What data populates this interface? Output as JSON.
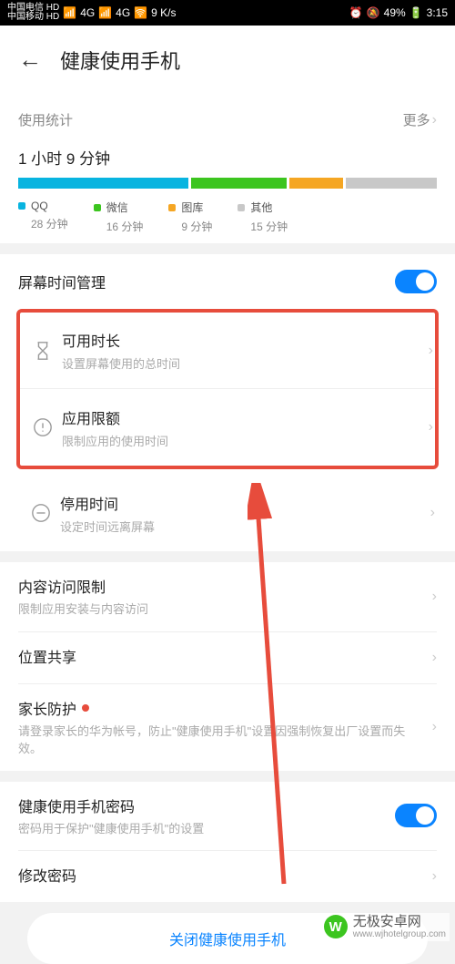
{
  "status": {
    "carrier1": "中国电信",
    "carrier2": "中国移动",
    "hd": "HD",
    "net": "4G",
    "speed": "9 K/s",
    "battery": "49%",
    "time": "3:15"
  },
  "header": {
    "title": "健康使用手机"
  },
  "stats": {
    "label": "使用统计",
    "more": "更多",
    "total": "1 小时 9 分钟",
    "legend": [
      {
        "name": "QQ",
        "value": "28 分钟",
        "color": "#08b4e0"
      },
      {
        "name": "微信",
        "value": "16 分钟",
        "color": "#3cc51f"
      },
      {
        "name": "图库",
        "value": "9 分钟",
        "color": "#f5a623"
      },
      {
        "name": "其他",
        "value": "15 分钟",
        "color": "#c8c8c8"
      }
    ]
  },
  "manage": {
    "label": "屏幕时间管理",
    "items": [
      {
        "title": "可用时长",
        "sub": "设置屏幕使用的总时间"
      },
      {
        "title": "应用限额",
        "sub": "限制应用的使用时间"
      }
    ],
    "downtime": {
      "title": "停用时间",
      "sub": "设定时间远离屏幕"
    }
  },
  "more_settings": {
    "content": {
      "title": "内容访问限制",
      "sub": "限制应用安装与内容访问"
    },
    "location": {
      "title": "位置共享"
    },
    "parental": {
      "title": "家长防护",
      "sub": "请登录家长的华为帐号，防止\"健康使用手机\"设置因强制恢复出厂设置而失效。"
    }
  },
  "password": {
    "title": "健康使用手机密码",
    "sub": "密码用于保护\"健康使用手机\"的设置",
    "change": "修改密码"
  },
  "close_btn": "关闭健康使用手机",
  "watermark": {
    "name": "无极安卓网",
    "url": "www.wjhotelgroup.com"
  },
  "chart_data": {
    "type": "bar",
    "title": "使用统计",
    "total_minutes": 69,
    "categories": [
      "QQ",
      "微信",
      "图库",
      "其他"
    ],
    "values": [
      28,
      16,
      9,
      15
    ],
    "unit": "分钟",
    "colors": [
      "#08b4e0",
      "#3cc51f",
      "#f5a623",
      "#c8c8c8"
    ]
  }
}
